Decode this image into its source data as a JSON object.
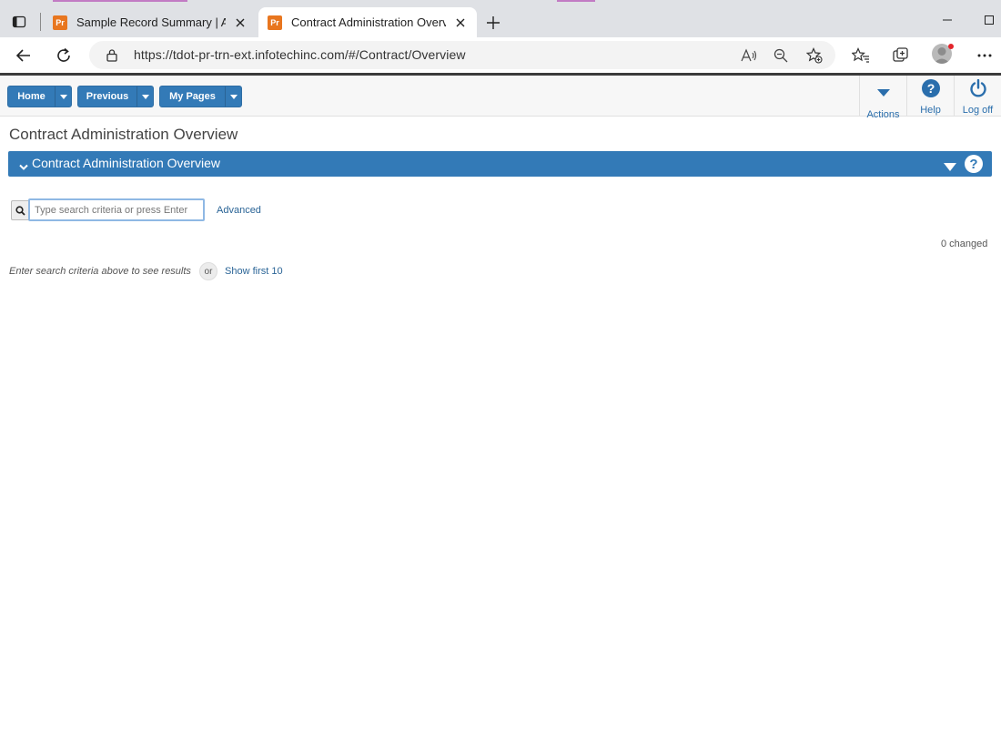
{
  "browser": {
    "tabs": [
      {
        "title": "Sample Record Summary | AASH",
        "favicon": "Pr",
        "active": false
      },
      {
        "title": "Contract Administration Overview",
        "favicon": "Pr",
        "active": true
      }
    ],
    "url": "https://tdot-pr-trn-ext.infotechinc.com/#/Contract/Overview",
    "accent_color": "#c27bc4"
  },
  "toolbar": {
    "home_label": "Home",
    "previous_label": "Previous",
    "mypages_label": "My Pages",
    "actions_label": "Actions",
    "help_label": "Help",
    "logoff_label": "Log off",
    "brand_color": "#337ab7"
  },
  "page": {
    "title": "Contract Administration Overview",
    "section_title": "Contract Administration Overview",
    "search": {
      "placeholder": "Type search criteria or press Enter",
      "value": "",
      "advanced_label": "Advanced"
    },
    "changed_count": "0 changed",
    "hint": "Enter search criteria above to see results",
    "or_label": "or",
    "show_first_label": "Show first 10"
  }
}
